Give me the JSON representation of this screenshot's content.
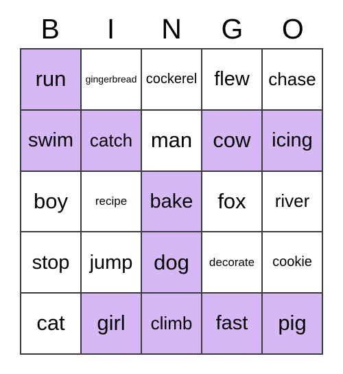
{
  "card": {
    "headers": [
      "B",
      "I",
      "N",
      "G",
      "O"
    ],
    "colors": {
      "marked_background": "#d6b8f5",
      "cell_background": "#ffffff",
      "border": "#3a3a3a",
      "text": "#000000"
    },
    "rows": [
      [
        {
          "text": "run",
          "marked": true,
          "size": "sz-xl"
        },
        {
          "text": "gingerbread",
          "marked": false,
          "size": "sz-xxs"
        },
        {
          "text": "cockerel",
          "marked": false,
          "size": "sz-sm"
        },
        {
          "text": "flew",
          "marked": false,
          "size": "sz-lg"
        },
        {
          "text": "chase",
          "marked": false,
          "size": "sz-md"
        }
      ],
      [
        {
          "text": "swim",
          "marked": true,
          "size": "sz-lg"
        },
        {
          "text": "catch",
          "marked": true,
          "size": "sz-md"
        },
        {
          "text": "man",
          "marked": false,
          "size": "sz-xl"
        },
        {
          "text": "cow",
          "marked": true,
          "size": "sz-xl"
        },
        {
          "text": "icing",
          "marked": true,
          "size": "sz-lg"
        }
      ],
      [
        {
          "text": "boy",
          "marked": false,
          "size": "sz-xl"
        },
        {
          "text": "recipe",
          "marked": false,
          "size": "sz-xs"
        },
        {
          "text": "bake",
          "marked": true,
          "size": "sz-lg"
        },
        {
          "text": "fox",
          "marked": false,
          "size": "sz-xl"
        },
        {
          "text": "river",
          "marked": false,
          "size": "sz-md"
        }
      ],
      [
        {
          "text": "stop",
          "marked": false,
          "size": "sz-lg"
        },
        {
          "text": "jump",
          "marked": false,
          "size": "sz-lg"
        },
        {
          "text": "dog",
          "marked": true,
          "size": "sz-xl"
        },
        {
          "text": "decorate",
          "marked": false,
          "size": "sz-xs"
        },
        {
          "text": "cookie",
          "marked": false,
          "size": "sz-sm"
        }
      ],
      [
        {
          "text": "cat",
          "marked": false,
          "size": "sz-xl"
        },
        {
          "text": "girl",
          "marked": true,
          "size": "sz-xl"
        },
        {
          "text": "climb",
          "marked": true,
          "size": "sz-md"
        },
        {
          "text": "fast",
          "marked": true,
          "size": "sz-lg"
        },
        {
          "text": "pig",
          "marked": true,
          "size": "sz-xl"
        }
      ]
    ]
  }
}
